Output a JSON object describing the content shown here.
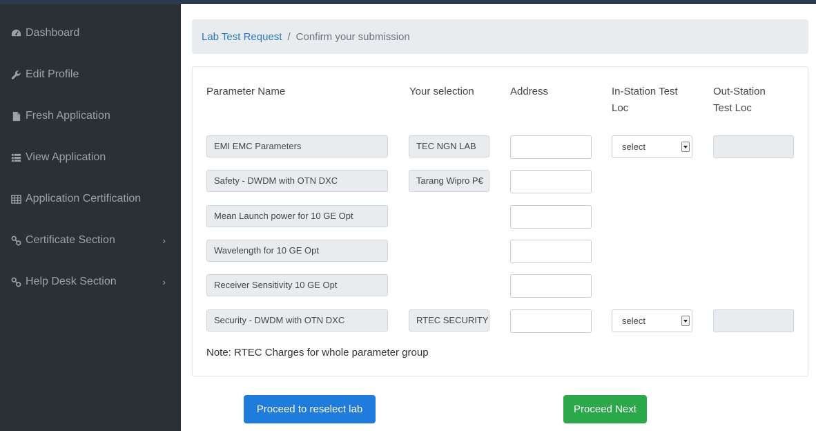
{
  "sidebar": {
    "items": [
      {
        "label": "Dashboard",
        "icon": "dashboard-icon"
      },
      {
        "label": "Edit Profile",
        "icon": "wrench-icon"
      },
      {
        "label": "Fresh Application",
        "icon": "file-icon"
      },
      {
        "label": "View Application",
        "icon": "list-icon"
      },
      {
        "label": "Application Certification",
        "icon": "table-icon"
      },
      {
        "label": "Certificate Section",
        "icon": "link-icon",
        "chevron": "›"
      },
      {
        "label": "Help Desk Section",
        "icon": "link-icon",
        "chevron": "›"
      }
    ]
  },
  "breadcrumb": {
    "link": "Lab Test Request",
    "separator": "/",
    "current": "Confirm your submission"
  },
  "table": {
    "headers": {
      "parameter": "Parameter Name",
      "selection": "Your selection",
      "address": "Address",
      "in_station_1": "In-Station Test",
      "in_station_2": "Loc",
      "out_station_1": "Out-Station",
      "out_station_2": "Test Loc"
    },
    "rows": [
      {
        "parameter": "EMI EMC Parameters",
        "selection": "TEC NGN LAB",
        "in_station": "select"
      },
      {
        "parameter": "Safety - DWDM with OTN DXC",
        "selection": "Tarang Wipro P€",
        "in_station": null
      },
      {
        "parameter": "Mean Launch power for 10 GE Opt",
        "selection": null,
        "in_station": null
      },
      {
        "parameter": "Wavelength for 10 GE Opt",
        "selection": null,
        "in_station": null
      },
      {
        "parameter": "Receiver Sensitivity 10 GE Opt",
        "selection": null,
        "in_station": null
      },
      {
        "parameter": "Security - DWDM with OTN DXC",
        "selection": "RTEC SECURITY",
        "in_station": "select"
      }
    ]
  },
  "note": "Note: RTEC Charges for whole parameter group",
  "buttons": {
    "reselect": "Proceed to reselect lab",
    "next": "Proceed Next"
  },
  "colors": {
    "sidebar_bg": "#2b3036",
    "link": "#2d76c1",
    "primary": "#1f7cdc",
    "success": "#2aa84a"
  }
}
